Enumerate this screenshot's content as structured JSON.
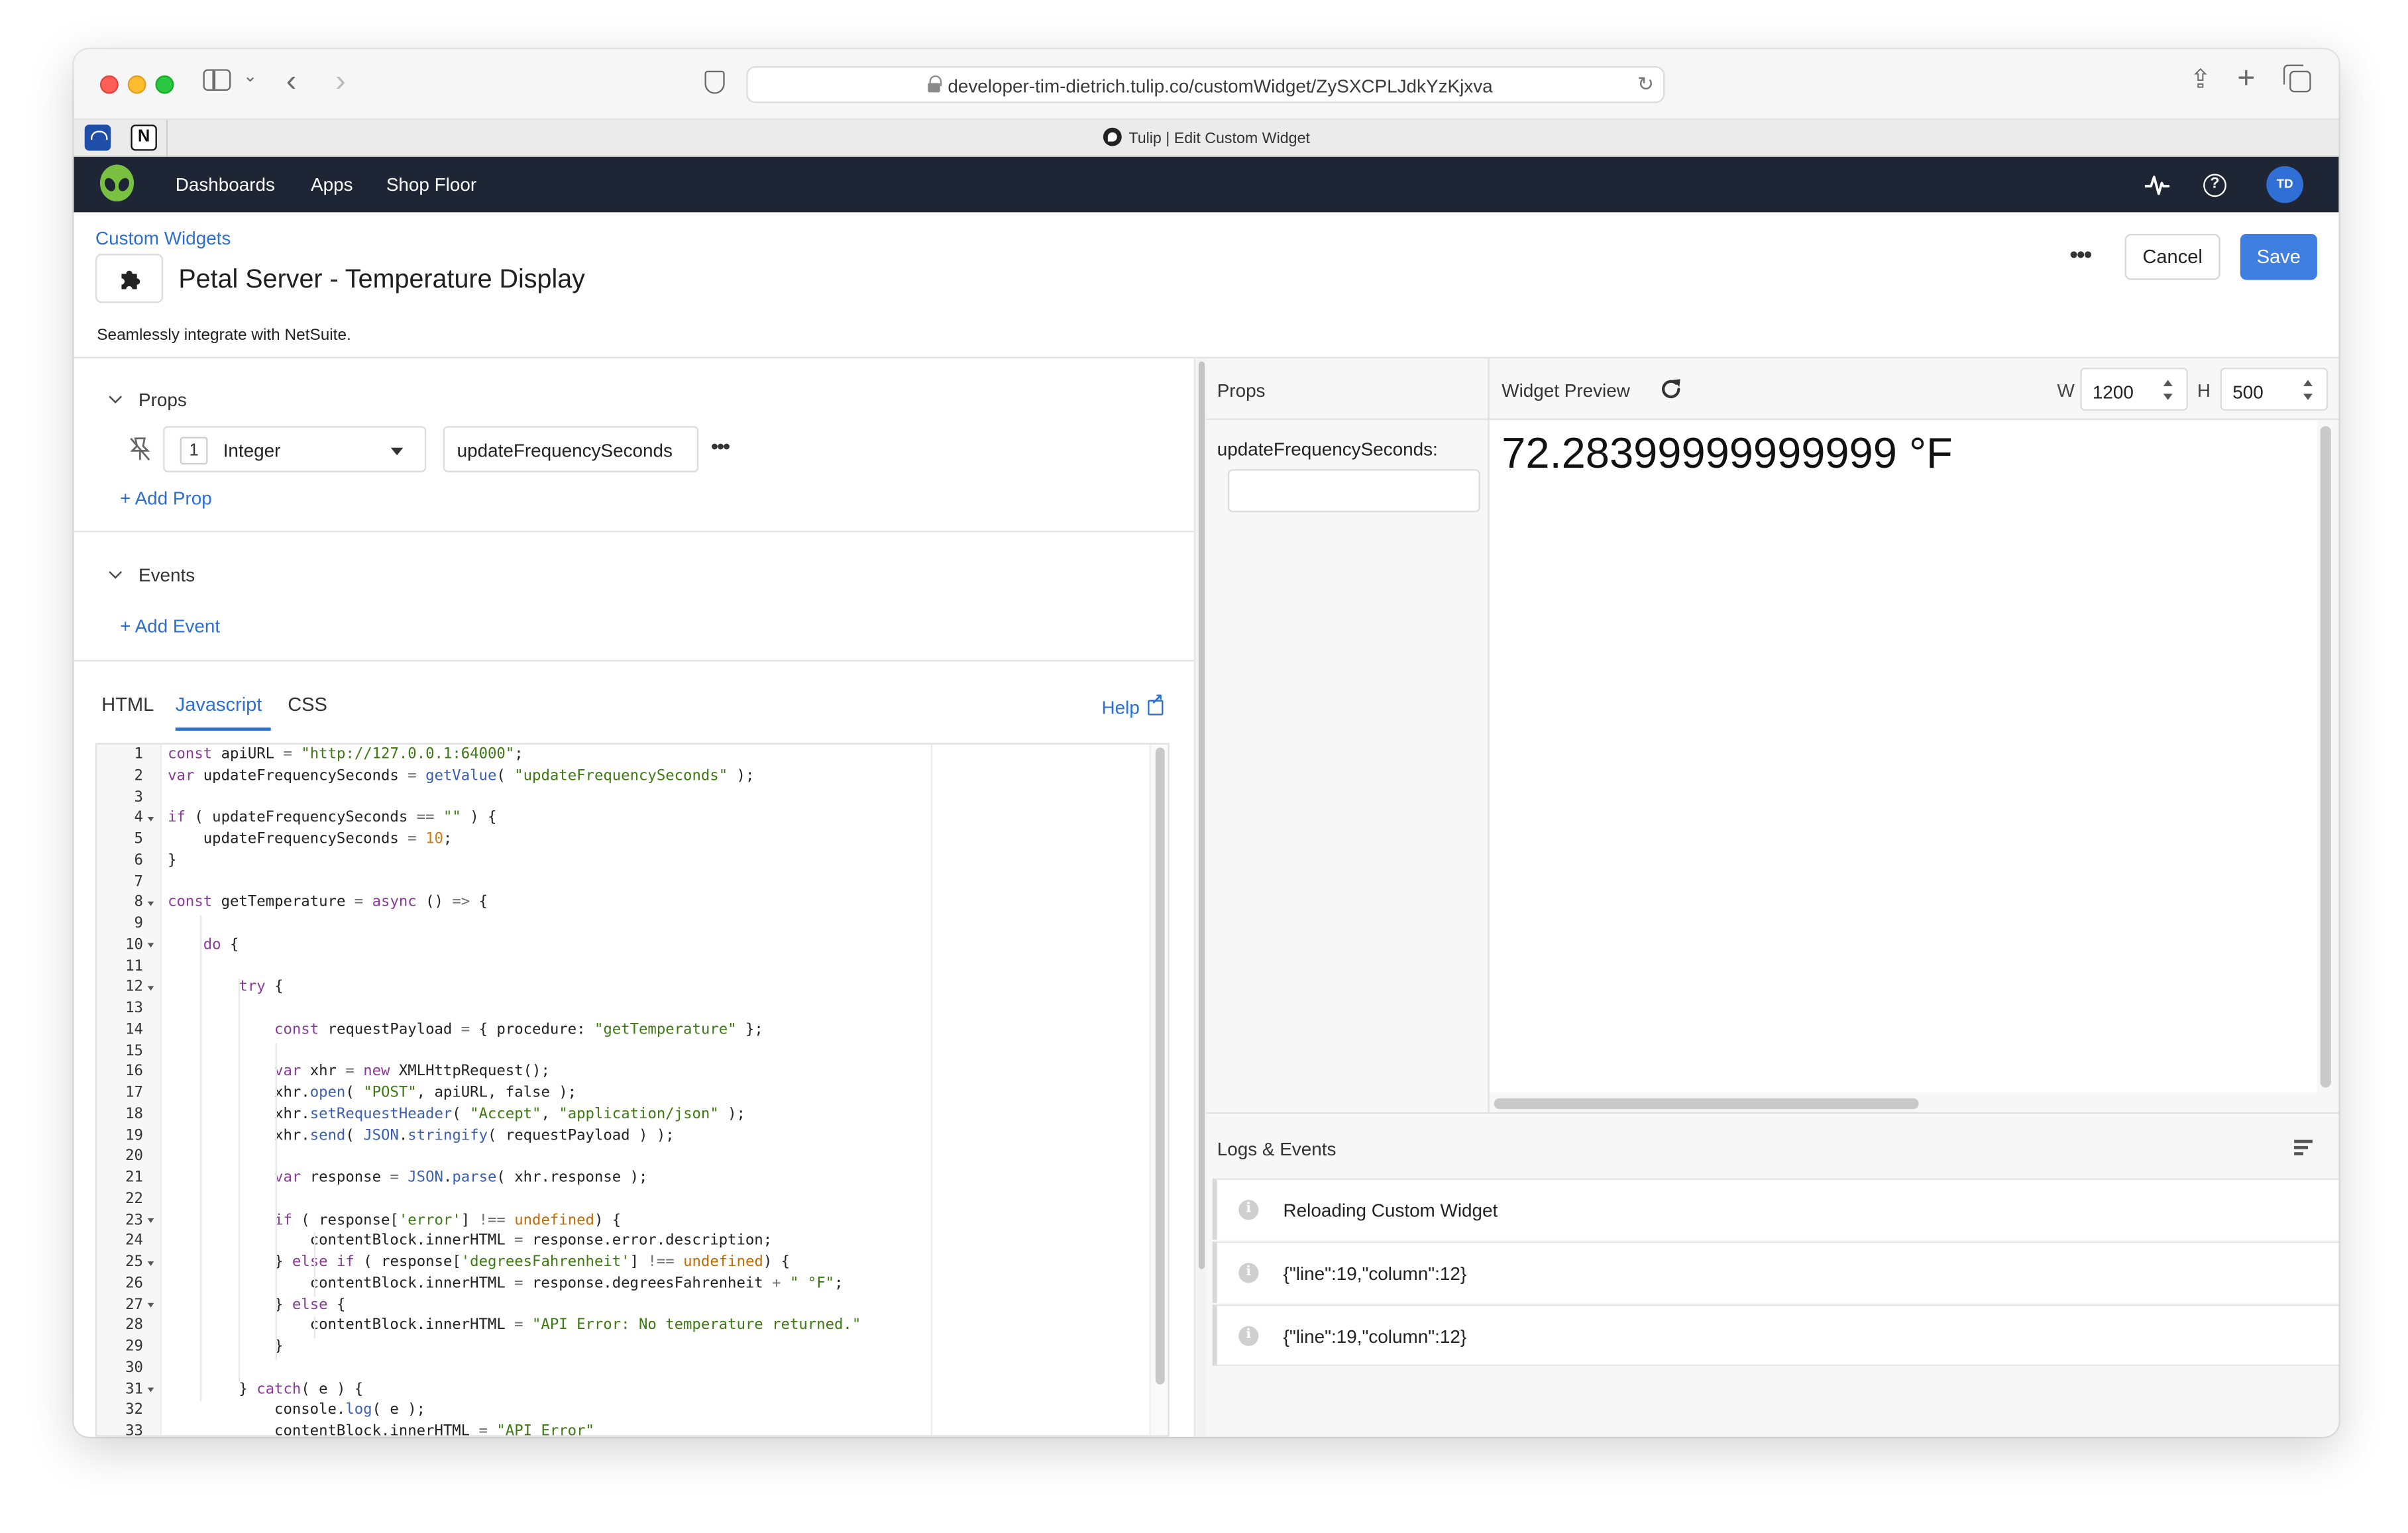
{
  "browser": {
    "url": "developer-tim-dietrich.tulip.co/customWidget/ZySXCPLJdkYzKjxva",
    "tab_title": "Tulip | Edit Custom Widget",
    "favorite_notion": "N"
  },
  "nav": {
    "items": [
      "Dashboards",
      "Apps",
      "Shop Floor"
    ],
    "help_glyph": "?",
    "avatar_initials": "TD"
  },
  "header": {
    "breadcrumb": "Custom Widgets",
    "title": "Petal Server - Temperature Display",
    "description": "Seamlessly integrate with NetSuite.",
    "more": "•••",
    "cancel_label": "Cancel",
    "save_label": "Save",
    "accent_color": "#3e7fe1"
  },
  "editor": {
    "props_heading": "Props",
    "prop": {
      "type_number": "1",
      "type": "Integer",
      "name": "updateFrequencySeconds",
      "more": "•••"
    },
    "add_prop": "+ Add Prop",
    "events_heading": "Events",
    "add_event": "+ Add Event",
    "tabs": [
      "HTML",
      "Javascript",
      "CSS"
    ],
    "active_tab": "Javascript",
    "help_label": "Help"
  },
  "code": {
    "lines": [
      "const apiURL = \"http://127.0.0.1:64000\";",
      "var updateFrequencySeconds = getValue( \"updateFrequencySeconds\" );",
      "",
      "if ( updateFrequencySeconds == \"\" ) {",
      "    updateFrequencySeconds = 10;",
      "}",
      "",
      "const getTemperature = async () => {",
      "",
      "    do {",
      "",
      "        try {",
      "",
      "            const requestPayload = { procedure: \"getTemperature\" };",
      "",
      "            var xhr = new XMLHttpRequest();",
      "            xhr.open( \"POST\", apiURL, false );",
      "            xhr.setRequestHeader( \"Accept\", \"application/json\" );",
      "            xhr.send( JSON.stringify( requestPayload ) );",
      "",
      "            var response = JSON.parse( xhr.response );",
      "",
      "            if ( response['error'] !== undefined) {",
      "                contentBlock.innerHTML = response.error.description;",
      "            } else if ( response['degreesFahrenheit'] !== undefined) {",
      "                contentBlock.innerHTML = response.degreesFahrenheit + \" °F\";",
      "            } else {",
      "                contentBlock.innerHTML = \"API Error: No temperature returned.\"",
      "            }",
      "",
      "        } catch( e ) {",
      "            console.log( e );",
      "            contentBlock.innerHTML = \"API Error\""
    ],
    "fold_lines": [
      4,
      8,
      10,
      12,
      23,
      25,
      27,
      31
    ]
  },
  "preview": {
    "props_heading": "Props",
    "prop_label": "updateFrequencySeconds:",
    "prop_value": "",
    "heading": "Widget Preview",
    "w_label": "W",
    "w_value": "1200",
    "h_label": "H",
    "h_value": "500",
    "output": "72.28399999999999 °F"
  },
  "logs": {
    "heading": "Logs & Events",
    "info_glyph": "i",
    "entries": [
      "Reloading Custom Widget",
      "{\"line\":19,\"column\":12}",
      "{\"line\":19,\"column\":12}"
    ]
  }
}
